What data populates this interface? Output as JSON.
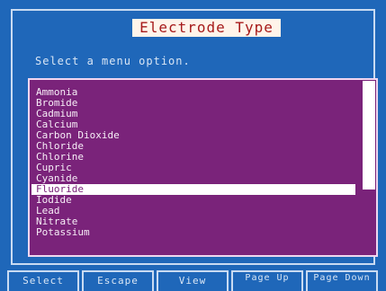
{
  "screen": {
    "title": "Electrode Type",
    "prompt": "Select a menu option."
  },
  "menu": {
    "items": [
      "Ammonia",
      "Bromide",
      "Cadmium",
      "Calcium",
      "Carbon Dioxide",
      "Chloride",
      "Chlorine",
      "Cupric",
      "Cyanide",
      "Fluoride",
      "Iodide",
      "Lead",
      "Nitrate",
      "Potassium"
    ],
    "selected": "Fluoride"
  },
  "function_keys": {
    "select": "Select",
    "escape": "Escape",
    "view": "View",
    "page_up": "Page Up",
    "page_down": "Page Down"
  },
  "colors": {
    "background": "#1f67b9",
    "list_background": "#7a237a",
    "highlight": "#ffffff",
    "title_background": "#fff4ea",
    "title_text": "#a61a1a"
  }
}
